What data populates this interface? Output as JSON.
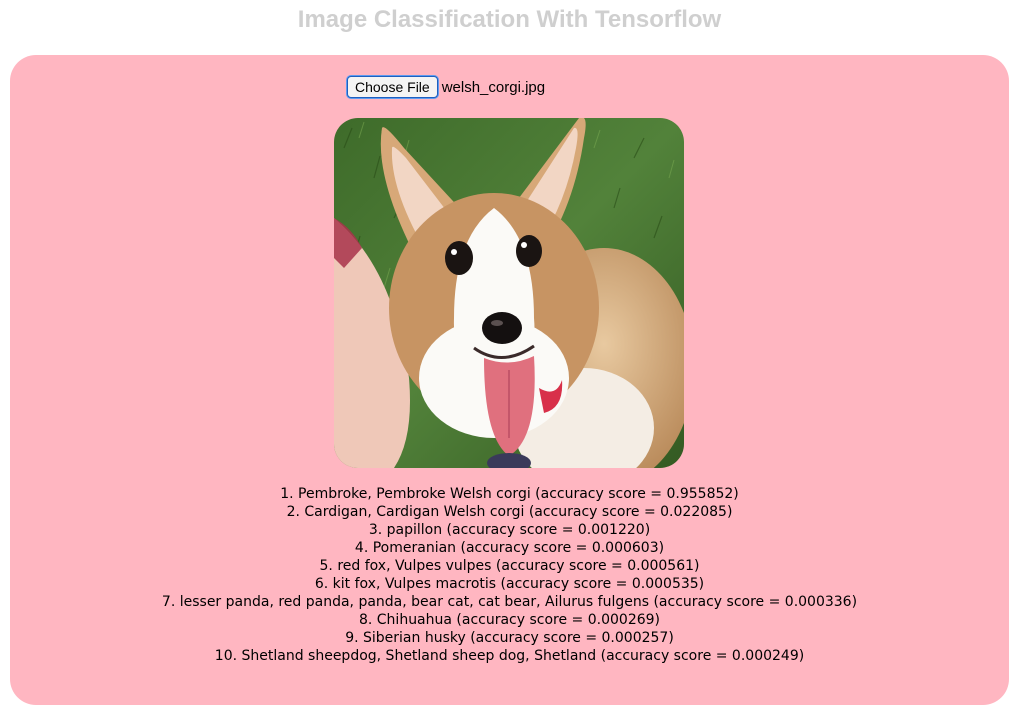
{
  "header": {
    "title": "Image Classification With Tensorflow"
  },
  "upload": {
    "button_label": "Choose File",
    "file_name": "welsh_corgi.jpg"
  },
  "preview": {
    "subject": "welsh corgi puppy on grass"
  },
  "results": [
    "1. Pembroke, Pembroke Welsh corgi (accuracy score = 0.955852)",
    "2. Cardigan, Cardigan Welsh corgi (accuracy score = 0.022085)",
    "3. papillon (accuracy score = 0.001220)",
    "4. Pomeranian (accuracy score = 0.000603)",
    "5. red fox, Vulpes vulpes (accuracy score = 0.000561)",
    "6. kit fox, Vulpes macrotis (accuracy score = 0.000535)",
    "7. lesser panda, red panda, panda, bear cat, cat bear, Ailurus fulgens (accuracy score = 0.000336)",
    "8. Chihuahua (accuracy score = 0.000269)",
    "9. Siberian husky (accuracy score = 0.000257)",
    "10. Shetland sheepdog, Shetland sheep dog, Shetland (accuracy score = 0.000249)"
  ],
  "colors": {
    "panel_background": "#ffb6c1",
    "title_color": "#cfcfcf"
  }
}
